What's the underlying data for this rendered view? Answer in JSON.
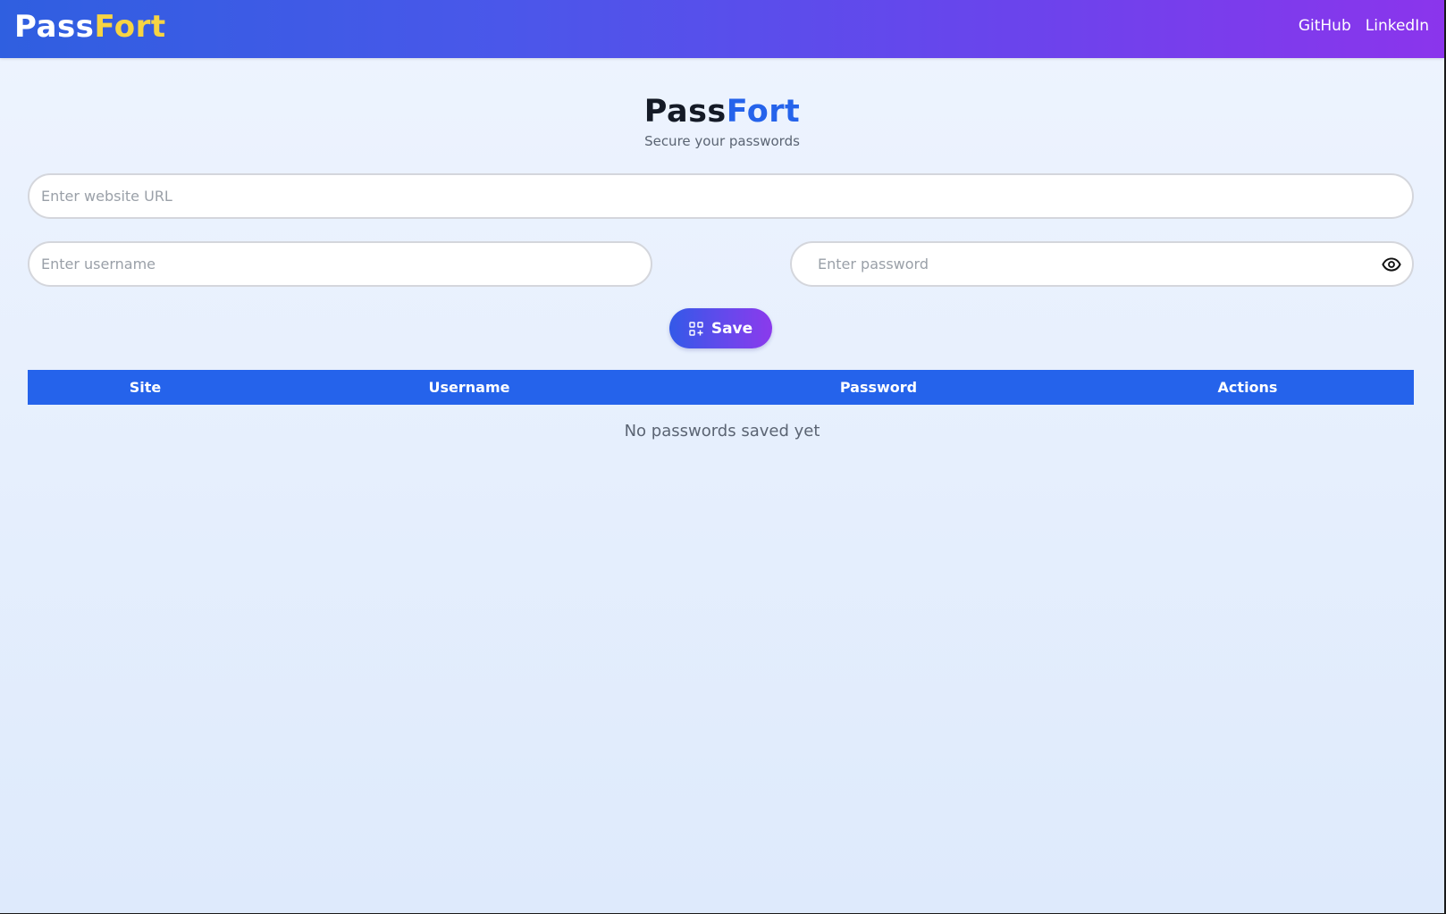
{
  "navbar": {
    "logo_part1": "Pass",
    "logo_part2": "Fort",
    "links": [
      "GitHub",
      "LinkedIn"
    ]
  },
  "hero": {
    "title_part1": "Pass",
    "title_part2": "Fort",
    "subtitle": "Secure your passwords"
  },
  "form": {
    "url_placeholder": "Enter website URL",
    "url_value": "",
    "username_placeholder": "Enter username",
    "username_value": "",
    "password_placeholder": "Enter password",
    "password_value": "",
    "password_toggle_icon": "eye-icon",
    "save_label": "Save",
    "save_icon": "add-grid-icon"
  },
  "table": {
    "headers": [
      "Site",
      "Username",
      "Password",
      "Actions"
    ],
    "rows": [],
    "empty_message": "No passwords saved yet"
  },
  "colors": {
    "accent": "#2563eb",
    "logo_highlight": "#f7d443",
    "nav_gradient_start": "#2f5fe0",
    "nav_gradient_end": "#8b35ec"
  }
}
